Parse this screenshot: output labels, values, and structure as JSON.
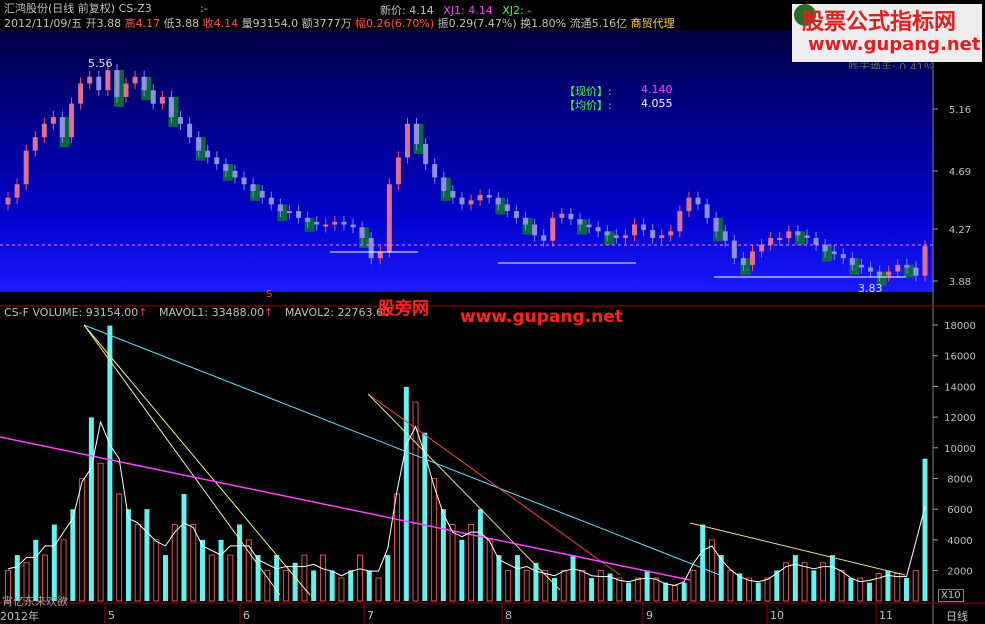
{
  "header": {
    "company": "汇鸿股份(日线 前复权)",
    "indicator": "CS-Z3",
    "indicator_sep": ":-",
    "date": "2012/11/09/五",
    "open_label": "开",
    "open": "3.88",
    "high_label": "高",
    "high": "4.17",
    "low_label": "低",
    "low": "3.88",
    "close_label": "收",
    "close": "4.14",
    "vol_label": "量",
    "volume": "93154.0",
    "amount_label": "额",
    "amount": "3777万",
    "change_label": "幅",
    "change": "0.26(6.70%)",
    "amp_label": "振",
    "amplitude": "0.29(7.47%)",
    "turn_label": "换",
    "turnover": "1.80%",
    "float_label": "流通",
    "float_value": "5.16亿",
    "sector": "商贸代理",
    "new_price_label": "新价:",
    "new_price": "4.14",
    "xj1_label": "XJ1:",
    "xj1": "4.14",
    "xj2_label": "XJ2:",
    "xj2": "-"
  },
  "watermark": {
    "title": "股票公式指标网",
    "url": "www.gupang.net",
    "hidden_text": "昨天换手: 0.41%",
    "center_cn": "股旁网",
    "center_url": "www.gupang.net"
  },
  "legend_box": {
    "current_label": "【现价】:",
    "current_value": "4.140",
    "avg_label": "【均价】:",
    "avg_value": "4.055"
  },
  "price_axis": {
    "ticks": [
      "5.16",
      "4.69",
      "4.27",
      "3.88"
    ]
  },
  "price_annotations": {
    "high_mark": "5.56",
    "low_mark": "3.83"
  },
  "volume_header": {
    "name": "CS-F VOLUME:",
    "volume": "93154.00",
    "mavol1_label": "MAVOL1:",
    "mavol1": "33488.00",
    "mavol2_label": "MAVOL2:",
    "mavol2": "22763.60",
    "s_marker": "S"
  },
  "volume_axis": {
    "ticks": [
      "18000",
      "16000",
      "14000",
      "12000",
      "10000",
      "8000",
      "6000",
      "4000",
      "2000"
    ],
    "unit": "X10"
  },
  "time_axis": {
    "year": "2012年",
    "months": [
      "5",
      "6",
      "7",
      "8",
      "9",
      "10",
      "11"
    ],
    "period": "日线"
  },
  "bottom_left_text": "宵亿东来欢欲",
  "colors": {
    "up": "#ff5050",
    "down": "#8080ff",
    "up_fill": "#e07090",
    "down_fill": "#9090e0",
    "vol_up": "#e05050",
    "vol_down": "#66f0f0",
    "blue_top": "#0000a0",
    "blue_bottom": "#3030ff"
  }
}
